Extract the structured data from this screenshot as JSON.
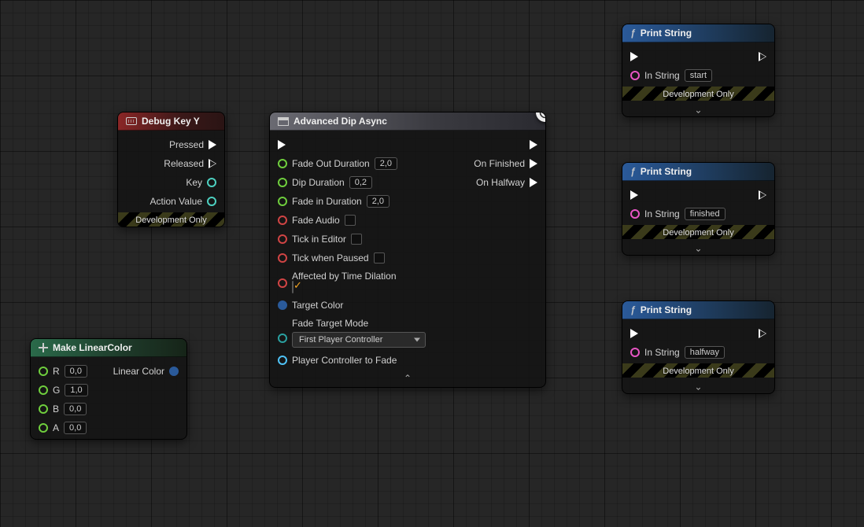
{
  "nodes": {
    "debugKey": {
      "title": "Debug Key Y",
      "pins": {
        "pressed": "Pressed",
        "released": "Released",
        "key": "Key",
        "actionValue": "Action Value"
      },
      "devOnly": "Development Only"
    },
    "linearColor": {
      "title": "Make LinearColor",
      "labels": {
        "r": "R",
        "g": "G",
        "b": "B",
        "a": "A",
        "out": "Linear Color"
      },
      "values": {
        "r": "0,0",
        "g": "1,0",
        "b": "0,0",
        "a": "0,0"
      }
    },
    "advDip": {
      "title": "Advanced Dip Async",
      "pins": {
        "fadeOut": "Fade Out Duration",
        "dipDur": "Dip Duration",
        "fadeIn": "Fade in Duration",
        "fadeAudio": "Fade Audio",
        "tickEditor": "Tick in Editor",
        "tickPaused": "Tick when Paused",
        "timeDilation": "Affected by Time Dilation",
        "targetColor": "Target Color",
        "fadeTargetMode": "Fade Target Mode",
        "playerController": "Player Controller to Fade",
        "onFinished": "On Finished",
        "onHalfway": "On Halfway"
      },
      "values": {
        "fadeOut": "2,0",
        "dipDur": "0,2",
        "fadeIn": "2,0",
        "fadeAudio": false,
        "tickEditor": false,
        "tickPaused": false,
        "timeDilation": true,
        "fadeTargetMode": "First Player Controller"
      }
    },
    "print1": {
      "title": "Print String",
      "inStringLabel": "In String",
      "inStringValue": "start",
      "devOnly": "Development Only"
    },
    "print2": {
      "title": "Print String",
      "inStringLabel": "In String",
      "inStringValue": "finished",
      "devOnly": "Development Only"
    },
    "print3": {
      "title": "Print String",
      "inStringLabel": "In String",
      "inStringValue": "halfway",
      "devOnly": "Development Only"
    }
  },
  "wires": [
    {
      "from": "debugKey.pressed",
      "to": "advDip.execIn"
    },
    {
      "from": "linearColor.out",
      "to": "advDip.targetColor"
    },
    {
      "from": "advDip.execOut",
      "to": "print1.execIn"
    },
    {
      "from": "advDip.onFinished",
      "to": "print2.execIn"
    },
    {
      "from": "advDip.onHalfway",
      "to": "print3.execIn"
    }
  ]
}
